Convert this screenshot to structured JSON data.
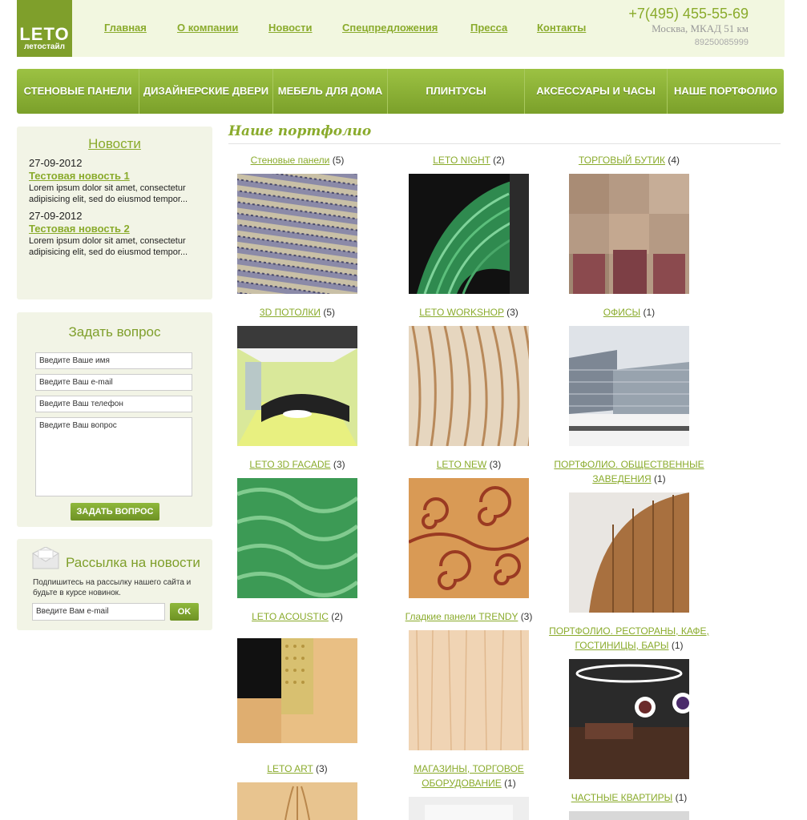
{
  "logo": {
    "main": "LETO",
    "sub": "летостайл"
  },
  "topnav": [
    {
      "label": "Главная"
    },
    {
      "label": "О компании"
    },
    {
      "label": "Новости"
    },
    {
      "label": "Спецпредложения"
    },
    {
      "label": "Пресса"
    },
    {
      "label": "Контакты"
    }
  ],
  "contacts": {
    "phone": "+7(495) 455-55-69",
    "address": "Москва, МКАД 51 км",
    "mobile": "89250085999"
  },
  "menu": [
    {
      "label": "Стеновые панели"
    },
    {
      "label": "Дизайнерские двери"
    },
    {
      "label": "Мебель для дома"
    },
    {
      "label": "Плинтусы"
    },
    {
      "label": "Аксессуары и часы"
    },
    {
      "label": "Наше портфолио"
    }
  ],
  "news": {
    "title": "Новости",
    "items": [
      {
        "date": "27-09-2012",
        "title": "Тестовая новость 1",
        "text": "Lorem ipsum dolor sit amet, consectetur adipisicing elit, sed do eiusmod tempor..."
      },
      {
        "date": "27-09-2012",
        "title": "Тестовая новость 2",
        "text": "Lorem ipsum dolor sit amet, consectetur adipisicing elit, sed do eiusmod tempor..."
      }
    ]
  },
  "ask": {
    "title": "Задать вопрос",
    "name_placeholder": "Введите Ваше имя",
    "email_placeholder": "Введите Ваш e-mail",
    "phone_placeholder": "Введите Ваш телефон",
    "question_placeholder": "Введите Ваш вопрос",
    "button": "ЗАДАТЬ ВОПРОС"
  },
  "subscribe": {
    "title": "Рассылка на новости",
    "text": "Подпишитесь на рассылку нашего сайта и будьте в курсе новинок.",
    "placeholder": "Введите Вам e-mail",
    "button": "OK"
  },
  "portfolio": {
    "title": "Наше портфолио",
    "items": [
      {
        "label": "Стеновые панели",
        "count": "(5)"
      },
      {
        "label": "LETO NIGHT",
        "count": "(2)"
      },
      {
        "label": "ТОРГОВЫЙ БУТИК",
        "count": "(4)"
      },
      {
        "label": "3D ПОТОЛКИ",
        "count": "(5)"
      },
      {
        "label": "LETO WORKSHOP",
        "count": "(3)"
      },
      {
        "label": "ОФИСЫ",
        "count": "(1)"
      },
      {
        "label": "LETO 3D FACADE",
        "count": "(3)"
      },
      {
        "label": "LETO NEW",
        "count": "(3)"
      },
      {
        "label": "ПОРТФОЛИО. ОБЩЕСТВЕННЫЕ ЗАВЕДЕНИЯ",
        "count": "(1)"
      },
      {
        "label": "LETO ACOUSTIC",
        "count": "(2)"
      },
      {
        "label": "Гладкие панели TRENDY",
        "count": "(3)"
      },
      {
        "label": "ПОРТФОЛИО. РЕСТОРАНЫ, КАФЕ, ГОСТИНИЦЫ, БАРЫ",
        "count": "(1)"
      },
      {
        "label": "LETO ART",
        "count": "(3)"
      },
      {
        "label": "МАГАЗИНЫ, ТОРГОВОЕ ОБОРУДОВАНИЕ",
        "count": "(1)"
      },
      {
        "label": "ЧАСТНЫЕ КВАРТИРЫ",
        "count": "(1)"
      }
    ]
  }
}
